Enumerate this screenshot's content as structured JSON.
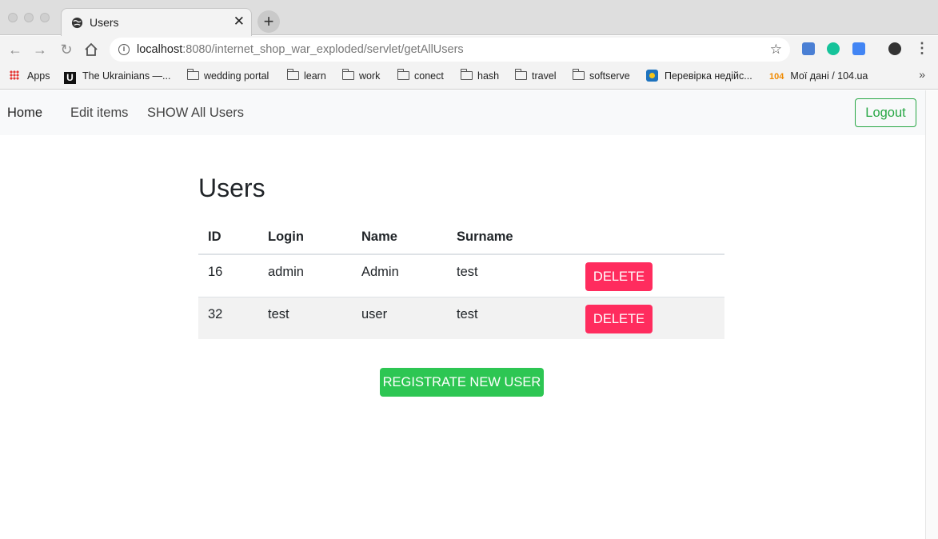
{
  "browser": {
    "tab_title": "Users",
    "url_host": "localhost",
    "url_rest": ":8080/internet_shop_war_exploded/servlet/getAllUsers",
    "bookmarks": [
      {
        "label": "Apps",
        "icon": "apps-grid-icon"
      },
      {
        "label": "The Ukrainians —...",
        "icon": "u-logo-icon"
      },
      {
        "label": "wedding portal",
        "icon": "folder-icon"
      },
      {
        "label": "learn",
        "icon": "folder-icon"
      },
      {
        "label": "work",
        "icon": "folder-icon"
      },
      {
        "label": "conect",
        "icon": "folder-icon"
      },
      {
        "label": "hash",
        "icon": "folder-icon"
      },
      {
        "label": "travel",
        "icon": "folder-icon"
      },
      {
        "label": "softserve",
        "icon": "folder-icon"
      },
      {
        "label": "Перевірка недійс...",
        "icon": "site-favicon-icon"
      },
      {
        "label": "Мої дані / 104.ua",
        "prefix": "104",
        "icon": "104-icon"
      }
    ]
  },
  "navbar": {
    "links": [
      "Home",
      "Edit items",
      "SHOW All Users"
    ],
    "logout_label": "Logout"
  },
  "main": {
    "title": "Users",
    "table": {
      "headers": [
        "ID",
        "Login",
        "Name",
        "Surname"
      ],
      "rows": [
        {
          "id": "16",
          "login": "admin",
          "name": "Admin",
          "surname": "test",
          "action": "DELETE"
        },
        {
          "id": "32",
          "login": "test",
          "name": "user",
          "surname": "test",
          "action": "DELETE"
        }
      ]
    },
    "register_label": "REGISTRATE NEW USER"
  },
  "colors": {
    "delete_button": "#ff2c5e",
    "register_button": "#2dc653",
    "logout_outline": "#28a745"
  }
}
